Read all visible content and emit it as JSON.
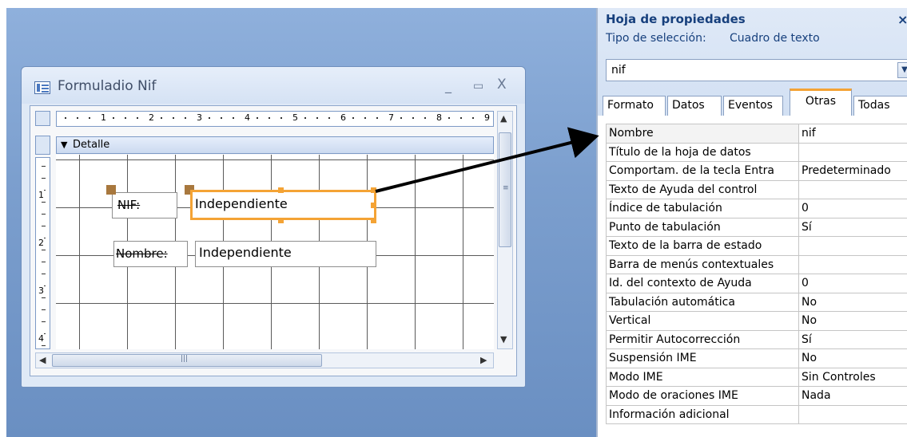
{
  "form_window": {
    "title": "Formuladio Nif",
    "minimize_glyph": "_",
    "maximize_glyph": "▭",
    "close_glyph": "X",
    "ruler_numbers": [
      "1",
      "2",
      "3",
      "4",
      "5",
      "6",
      "7",
      "8",
      "9"
    ],
    "vruler_numbers": [
      "1",
      "2",
      "3",
      "4"
    ],
    "section_arrow_glyph": "▼",
    "section_label": "Detalle",
    "controls": {
      "nif_label": "NIF:",
      "nif_textbox": "Independiente",
      "nombre_label": "Nombre:",
      "nombre_textbox": "Independiente"
    }
  },
  "property_sheet": {
    "title": "Hoja de propiedades",
    "close_glyph": "×",
    "selection_type_label": "Tipo de selección:",
    "selection_type_value": "Cuadro de texto",
    "object_combo_value": "nif",
    "tabs": [
      "Formato",
      "Datos",
      "Eventos",
      "Otras",
      "Todas"
    ],
    "active_tab": "Otras",
    "properties": [
      {
        "name": "Nombre",
        "value": "nif"
      },
      {
        "name": "Título de la hoja de datos",
        "value": ""
      },
      {
        "name": "Comportam. de la tecla Entra",
        "value": "Predeterminado"
      },
      {
        "name": "Texto de Ayuda del control",
        "value": ""
      },
      {
        "name": "Índice de tabulación",
        "value": "0"
      },
      {
        "name": "Punto de tabulación",
        "value": "Sí"
      },
      {
        "name": "Texto de la barra de estado",
        "value": ""
      },
      {
        "name": "Barra de menús contextuales",
        "value": ""
      },
      {
        "name": "Id. del contexto de Ayuda",
        "value": "0"
      },
      {
        "name": "Tabulación automática",
        "value": "No"
      },
      {
        "name": "Vertical",
        "value": "No"
      },
      {
        "name": "Permitir Autocorrección",
        "value": "Sí"
      },
      {
        "name": "Suspensión IME",
        "value": "No"
      },
      {
        "name": "Modo IME",
        "value": "Sin Controles"
      },
      {
        "name": "Modo de oraciones IME",
        "value": "Nada"
      },
      {
        "name": "Información adicional",
        "value": ""
      }
    ]
  },
  "colors": {
    "selection_accent": "#f4a335",
    "title_text": "#17407d",
    "desktop": "#7c9fce"
  }
}
